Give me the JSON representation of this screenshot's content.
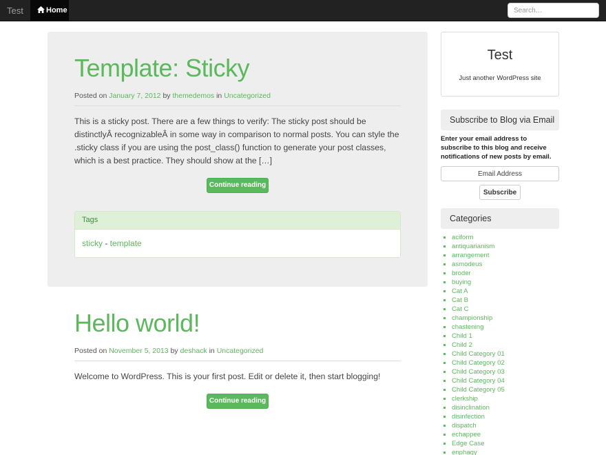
{
  "navbar": {
    "brand": "Test",
    "home_label": "Home",
    "search_placeholder": "Search…"
  },
  "posts": [
    {
      "title": "Template: Sticky",
      "posted_on_label": "Posted on",
      "date": "January 7, 2012",
      "by_label": "by",
      "author": "themedemos",
      "in_label": "in",
      "category": "Uncategorized",
      "excerpt": "This is a sticky post. There are a few things to verify: The sticky post should be distinctlyÂ recognizableÂ in some way in comparison to normal posts. You can style the .sticky class if you are using the post_class() function to generate your post classes, which is a best practice. They should show at the […]",
      "continue_label": "Continue reading",
      "tags_heading": "Tags",
      "tags": [
        "sticky",
        "template"
      ],
      "tag_separator": " - "
    },
    {
      "title": "Hello world!",
      "posted_on_label": "Posted on",
      "date": "November 5, 2013",
      "by_label": "by",
      "author": "deshack",
      "in_label": "in",
      "category": "Uncategorized",
      "excerpt": "Welcome to WordPress. This is your first post. Edit or delete it, then start blogging!",
      "continue_label": "Continue reading"
    }
  ],
  "sidebar": {
    "site_title": "Test",
    "site_tagline": "Just another WordPress site",
    "subscribe": {
      "title": "Subscribe to Blog via Email",
      "text": "Enter your email address to subscribe to this blog and receive notifications of new posts by email.",
      "email_placeholder": "Email Address",
      "button_label": "Subscribe"
    },
    "categories": {
      "title": "Categories",
      "items": [
        "aciform",
        "antiquarianism",
        "arrangement",
        "asmodeus",
        "broder",
        "buying",
        "Cat A",
        "Cat B",
        "Cat C",
        "championship",
        "chastening",
        "Child 1",
        "Child 2",
        "Child Category 01",
        "Child Category 02",
        "Child Category 03",
        "Child Category 04",
        "Child Category 05",
        "clerkship",
        "disinclination",
        "disinfection",
        "dispatch",
        "echappee",
        "Edge Case",
        "enphagy"
      ]
    }
  },
  "colors": {
    "accent": "#5cb85c",
    "navbar": "#222222",
    "sticky_bg": "#eeeeee"
  }
}
